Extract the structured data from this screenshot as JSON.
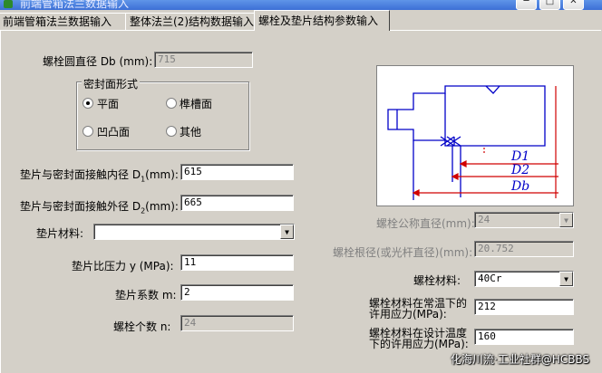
{
  "window": {
    "title": "前端管箱法兰数据输入"
  },
  "tabs": [
    {
      "label": "前端管箱法兰数据输入"
    },
    {
      "label": "整体法兰(2)结构数据输入"
    },
    {
      "label": "螺栓及垫片结构参数输入"
    }
  ],
  "form": {
    "db_label": "螺栓圆直径 Db (mm):",
    "db_value": "715",
    "seal_group_title": "密封面形式",
    "seal_flat": "平面",
    "seal_groove": "榫槽面",
    "seal_concave": "凹凸面",
    "seal_other": "其他",
    "d1_label": "垫片与密封面接触内径 D",
    "d1_sub": "1",
    "d1_suffix": "(mm):",
    "d1_value": "615",
    "d2_label": "垫片与密封面接触外径 D",
    "d2_sub": "2",
    "d2_suffix": "(mm):",
    "d2_value": "665",
    "gasket_material_label": "垫片材料:",
    "gasket_material_value": "",
    "y_label": "垫片比压力 y (MPa):",
    "y_value": "11",
    "m_label": "垫片系数 m:",
    "m_value": "2",
    "n_label": "螺栓个数 n:",
    "n_value": "24",
    "bolt_nominal_label": "螺栓公称直径(mm):",
    "bolt_nominal_value": "24",
    "bolt_root_label": "螺栓根径(或光杆直径)(mm):",
    "bolt_root_value": "20.752",
    "bolt_material_label": "螺栓材料:",
    "bolt_material_value": "40Cr",
    "stress_room_label_1": "螺栓材料在常温下的",
    "stress_room_label_2": "许用应力(MPa):",
    "stress_room_value": "212",
    "stress_design_label_1": "螺栓材料在设计温度",
    "stress_design_label_2": "下的许用应力(MPa):",
    "stress_design_value": "160"
  },
  "diagram": {
    "label_d1": "D1",
    "label_d2": "D2",
    "label_db": "Db"
  },
  "watermark": "化海川流·工业社群@HCBBS",
  "colors": {
    "diagram_line": "#0000c8",
    "diagram_red": "#d00000"
  }
}
